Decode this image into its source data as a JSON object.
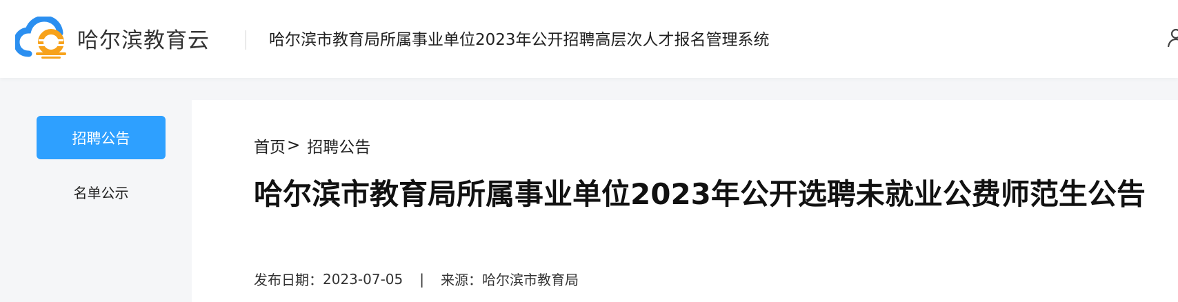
{
  "header": {
    "logo_text": "哈尔滨教育云",
    "system_title": "哈尔滨市教育局所属事业单位2023年公开招聘高层次人才报名管理系统",
    "user_icon": "user-icon"
  },
  "sidebar": {
    "items": [
      {
        "label": "招聘公告",
        "active": true
      },
      {
        "label": "名单公示",
        "active": false
      }
    ]
  },
  "breadcrumb": {
    "home": "首页",
    "separator": ">",
    "current": "招聘公告"
  },
  "article": {
    "title": "哈尔滨市教育局所属事业单位2023年公开选聘未就业公费师范生公告",
    "date_label": "发布日期：",
    "date": "2023-07-05",
    "divider": "|",
    "source_label": "来源：",
    "source": "哈尔滨市教育局"
  },
  "colors": {
    "accent": "#2ea0ff",
    "logo_blue": "#2b8ff0",
    "logo_orange": "#f7a21b"
  }
}
